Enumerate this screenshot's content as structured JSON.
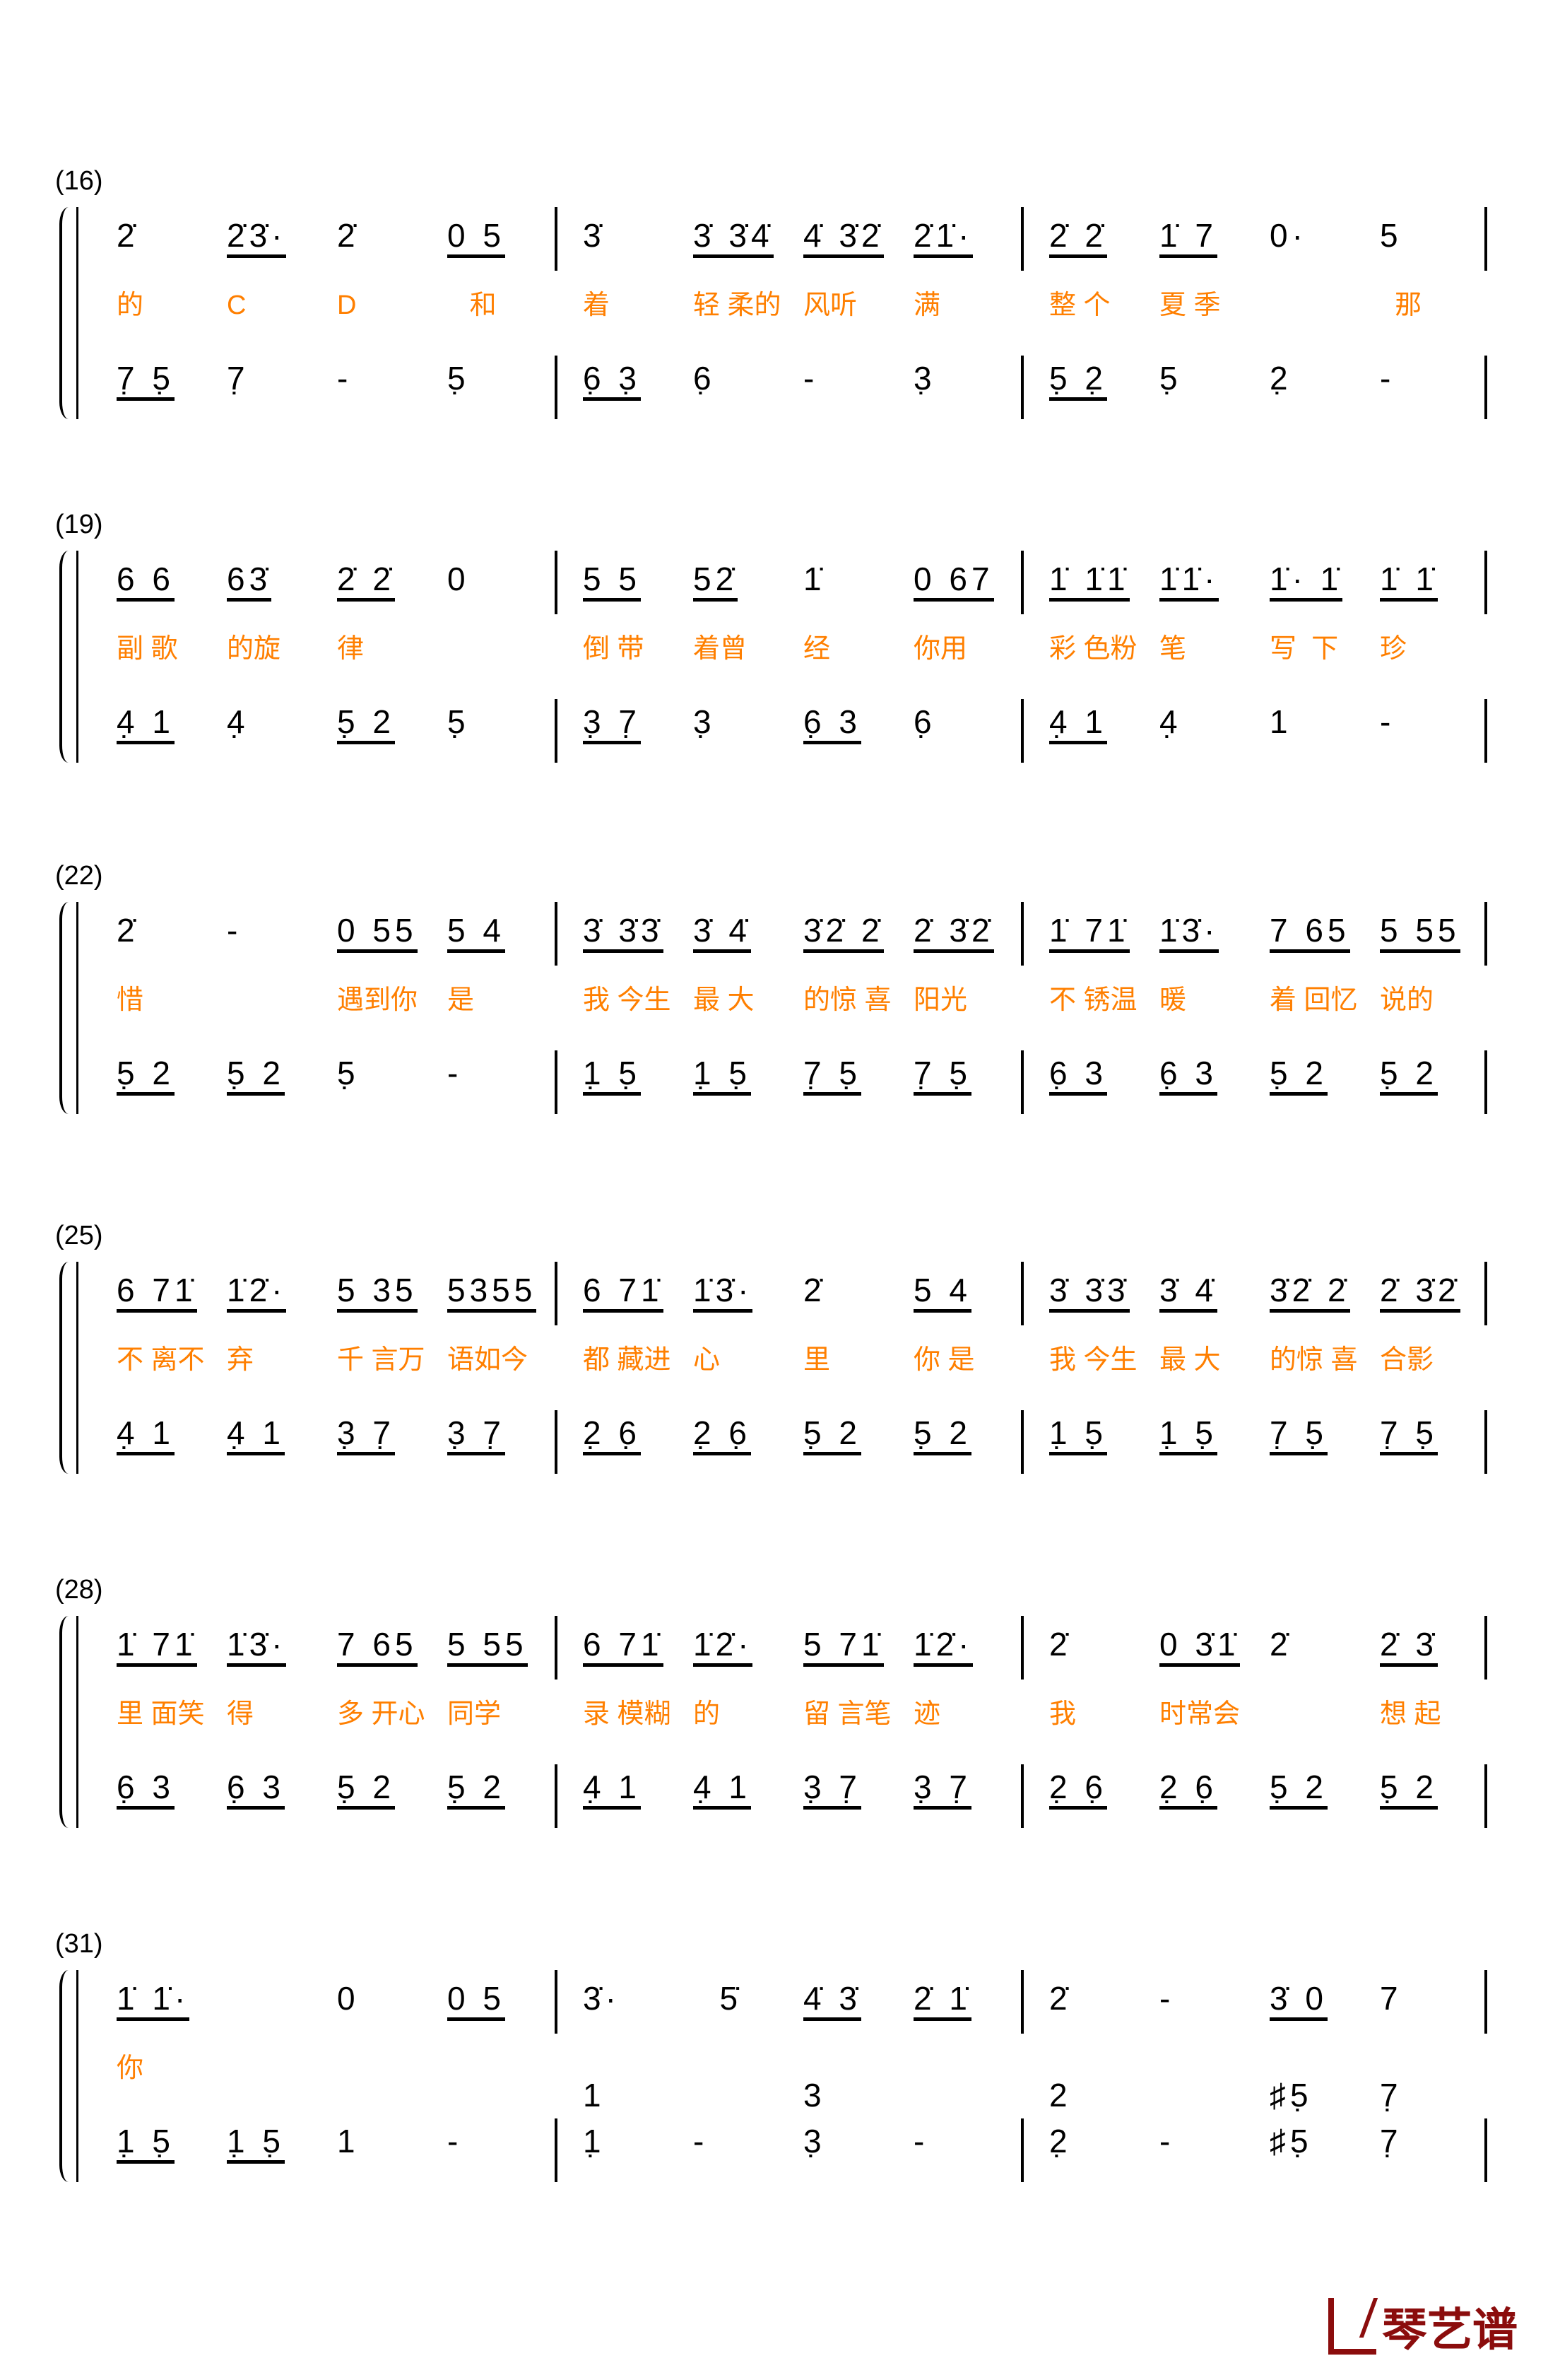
{
  "logo_text": "琴艺谱",
  "colors": {
    "lyrics": "#ff7f00",
    "notes": "#000000",
    "logo": "#8b0d0d"
  },
  "systems": [
    {
      "label": "(16)",
      "measures": [
        {
          "melody": [
            "2̇",
            "2̇3̇·",
            "2̇",
            "0 5"
          ],
          "lyrics": [
            "的",
            "C",
            "D",
            "   和"
          ],
          "bass": [
            "7̣ 5̣",
            "7̣",
            "-",
            "5̣"
          ]
        },
        {
          "melody": [
            "3̇",
            "3̇ 3̇4̇",
            "4̇ 3̇2̇",
            "2̇1̇·"
          ],
          "lyrics": [
            "着",
            "轻 柔的",
            "风听",
            "满"
          ],
          "bass": [
            "6̣ 3̣",
            "6̣",
            "-",
            "3̣"
          ]
        },
        {
          "melody": [
            "2̇ 2̇",
            "1̇ 7",
            "0·",
            "5"
          ],
          "lyrics": [
            "整 个",
            "夏 季",
            "",
            "  那"
          ],
          "bass": [
            "5̣ 2̣",
            "5̣",
            "2̣",
            "-"
          ]
        }
      ]
    },
    {
      "label": "(19)",
      "measures": [
        {
          "melody": [
            "6 6",
            "63̇",
            "2̇ 2̇",
            "0"
          ],
          "lyrics": [
            "副 歌",
            "的旋",
            "律",
            ""
          ],
          "bass": [
            "4̣ 1",
            "4̣",
            "5̣ 2",
            "5̣"
          ]
        },
        {
          "melody": [
            "5 5",
            "52̇",
            "1̇",
            "0 67"
          ],
          "lyrics": [
            "倒 带",
            "着曾",
            "经",
            "你用"
          ],
          "bass": [
            "3̣ 7̣",
            "3̣",
            "6̣ 3",
            "6̣"
          ]
        },
        {
          "melody": [
            "1̇ 1̇1̇",
            "1̇1̇·",
            "1̇· 1̇",
            "1̇ 1̇"
          ],
          "lyrics": [
            "彩 色粉",
            "笔",
            "写  下",
            "珍"
          ],
          "bass": [
            "4̣ 1",
            "4̣",
            "1",
            "-"
          ]
        }
      ]
    },
    {
      "label": "(22)",
      "measures": [
        {
          "melody": [
            "2̇",
            "-",
            "0 55",
            "5 4"
          ],
          "lyrics": [
            "惜",
            "",
            "遇到你",
            "是"
          ],
          "bass": [
            "5̣ 2",
            "5̣ 2",
            "5̣",
            "-"
          ]
        },
        {
          "melody": [
            "3̇ 3̇3̇",
            "3̇ 4̇",
            "3̇2̇ 2̇",
            "2̇ 3̇2̇"
          ],
          "lyrics": [
            "我 今生",
            "最 大",
            "的惊 喜",
            "阳光"
          ],
          "bass": [
            "1̣ 5̣",
            "1̣ 5̣",
            "7̣ 5̣",
            "7̣ 5̣"
          ]
        },
        {
          "melody": [
            "1̇ 71̇",
            "1̇3̇·",
            "7 65",
            "5 55"
          ],
          "lyrics": [
            "不 锈温",
            "暖",
            "着 回忆",
            "说的"
          ],
          "bass": [
            "6̣ 3",
            "6̣ 3",
            "5̣ 2",
            "5̣ 2"
          ]
        }
      ]
    },
    {
      "label": "(25)",
      "measures": [
        {
          "melody": [
            "6 71̇",
            "1̇2̇·",
            "5 35",
            "5355"
          ],
          "lyrics": [
            "不 离不",
            "弃",
            "千 言万",
            "语如今"
          ],
          "bass": [
            "4̣ 1",
            "4̣ 1",
            "3̣ 7̣",
            "3̣ 7̣"
          ]
        },
        {
          "melody": [
            "6 71̇",
            "1̇3̇·",
            "2̇",
            "5 4"
          ],
          "lyrics": [
            "都 藏进",
            "心",
            "里",
            "你 是"
          ],
          "bass": [
            "2̣ 6̣",
            "2̣ 6̣",
            "5̣ 2",
            "5̣ 2"
          ]
        },
        {
          "melody": [
            "3̇ 3̇3̇",
            "3̇ 4̇",
            "3̇2̇ 2̇",
            "2̇ 3̇2̇"
          ],
          "lyrics": [
            "我 今生",
            "最 大",
            "的惊 喜",
            "合影"
          ],
          "bass": [
            "1̣ 5̣",
            "1̣ 5̣",
            "7̣ 5̣",
            "7̣ 5̣"
          ]
        }
      ]
    },
    {
      "label": "(28)",
      "measures": [
        {
          "melody": [
            "1̇ 71̇",
            "1̇3̇·",
            "7 65",
            "5 55"
          ],
          "lyrics": [
            "里 面笑",
            "得",
            "多 开心",
            "同学"
          ],
          "bass": [
            "6̣ 3",
            "6̣ 3",
            "5̣ 2",
            "5̣ 2"
          ]
        },
        {
          "melody": [
            "6 71̇",
            "1̇2̇·",
            "5 71̇",
            "1̇2̇·"
          ],
          "lyrics": [
            "录 模糊",
            "的",
            "留 言笔",
            "迹"
          ],
          "bass": [
            "4̣ 1",
            "4̣ 1",
            "3̣ 7̣",
            "3̣ 7̣"
          ]
        },
        {
          "melody": [
            "2̇",
            "0 3̇1̇",
            "2̇",
            "2̇ 3̇"
          ],
          "lyrics": [
            "我",
            "时常会",
            "",
            "想 起"
          ],
          "bass": [
            "2̣ 6̣",
            "2̣ 6̣",
            "5̣ 2",
            "5̣ 2"
          ]
        }
      ]
    },
    {
      "label": "(31)",
      "measures": [
        {
          "melody": [
            "1̇ 1̇·",
            "",
            "0",
            "0 5"
          ],
          "lyrics": [
            "你",
            "",
            "",
            ""
          ],
          "bass": [
            "1̣ 5̣",
            "1̣ 5̣",
            "1",
            "-"
          ],
          "upper": [
            "",
            "",
            "",
            ""
          ]
        },
        {
          "melody": [
            "3̇·",
            "  5̇",
            "4̇ 3̇",
            "2̇ 1̇"
          ],
          "lyrics": [
            "",
            "",
            "",
            ""
          ],
          "bass": [
            "1̣",
            "-",
            "3̣",
            "-"
          ],
          "upper": [
            "1",
            "",
            "3",
            ""
          ]
        },
        {
          "melody": [
            "2̇",
            "-",
            "3̇ 0",
            "7"
          ],
          "lyrics": [
            "",
            "",
            "",
            ""
          ],
          "bass": [
            "2̣",
            "-",
            "♯5̣",
            "7̣"
          ],
          "upper": [
            "2",
            "",
            "♯5̣",
            "7̣"
          ]
        }
      ]
    }
  ]
}
